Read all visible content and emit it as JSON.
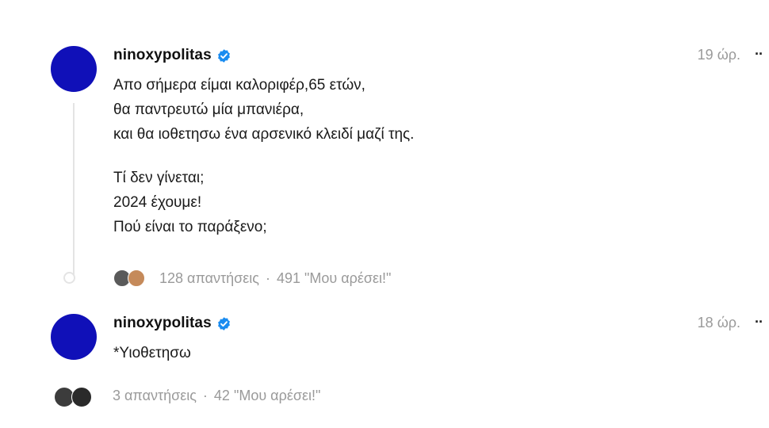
{
  "posts": [
    {
      "username": "ninoxypolitas",
      "verified": true,
      "time": "19 ώρ.",
      "more": "··",
      "lines": [
        "Απο σήμερα είμαι καλοριφέρ,65 ετών,",
        "θα παντρευτώ μία μπανιέρα,",
        "και θα ιοθετησω ένα αρσενικό κλειδί μαζί της.",
        "",
        "Τί δεν γίνεται;",
        "2024 έχουμε!",
        "Πού είναι το παράξενο;"
      ],
      "replies": "128 απαντήσεις",
      "separator": "·",
      "likes": "491 \"Μου αρέσει!\""
    },
    {
      "username": "ninoxypolitas",
      "verified": true,
      "time": "18 ώρ.",
      "more": "··",
      "lines": [
        "*Υιοθετησω"
      ],
      "replies": "3 απαντήσεις",
      "separator": "·",
      "likes": "42 \"Μου αρέσει!\""
    }
  ],
  "colors": {
    "avatar": "#1010b8",
    "verified": "#1a8cf0",
    "muted": "#9a9a9a",
    "thread_line": "#e4e4e4"
  },
  "icons": {
    "verified": "verified-badge-icon",
    "more": "more-options-icon"
  }
}
